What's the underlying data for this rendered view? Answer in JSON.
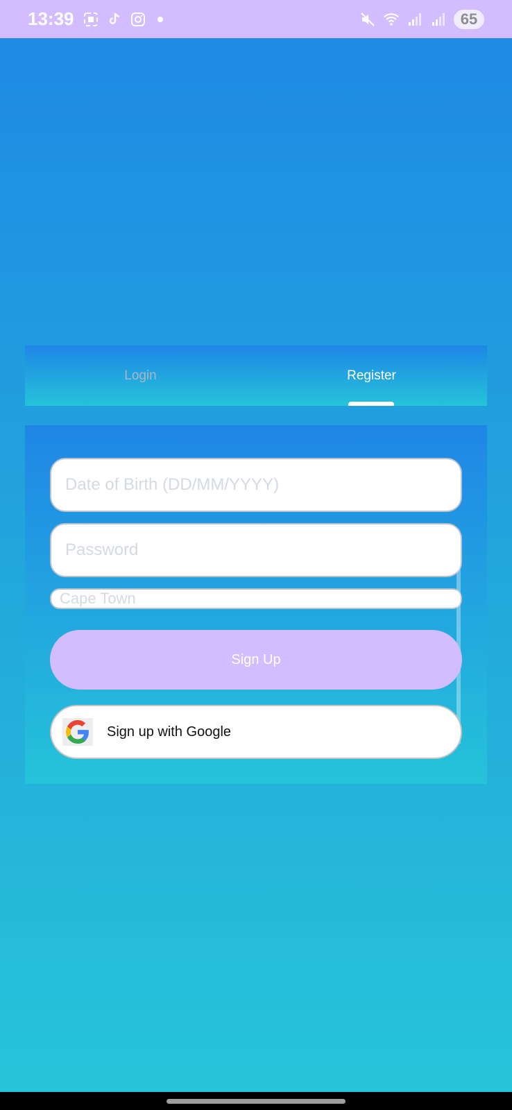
{
  "status_bar": {
    "time": "13:39",
    "left_icons": [
      "screenshot-icon",
      "tiktok-icon",
      "instagram-icon",
      "notification-dot"
    ],
    "right_icons": [
      "mute-icon",
      "wifi-icon",
      "signal-icon",
      "signal-icon"
    ],
    "battery": "65"
  },
  "tabs": {
    "login": "Login",
    "register": "Register",
    "active": "register"
  },
  "form": {
    "dob_placeholder": "Date of Birth (DD/MM/YYYY)",
    "password_placeholder": "Password",
    "city_value": "Cape Town",
    "signup_label": "Sign Up",
    "google_label": "Sign up with Google"
  },
  "colors": {
    "accent": "#d3bcff",
    "gradient_top": "#1e88e5",
    "gradient_bottom": "#27c5d9"
  }
}
